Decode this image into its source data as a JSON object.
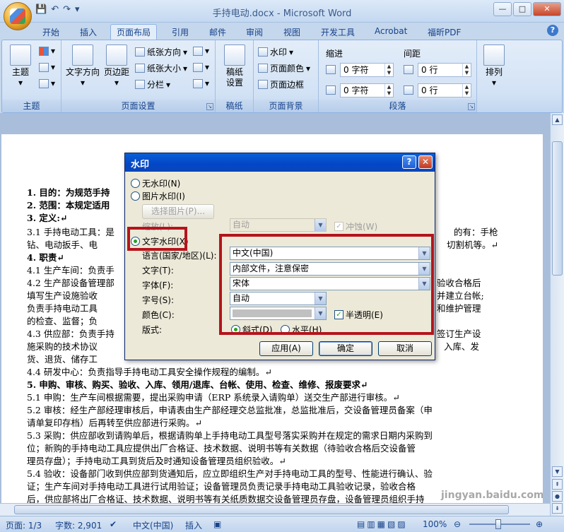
{
  "window": {
    "title": "手持电动.docx - Microsoft Word",
    "buttons": {
      "minimize": "—",
      "maximize": "□",
      "close": "✕"
    }
  },
  "qat": {
    "save": "💾",
    "undo": "↶",
    "redo": "↷",
    "customize": "▾"
  },
  "tabs": [
    "开始",
    "插入",
    "页面布局",
    "引用",
    "邮件",
    "审阅",
    "视图",
    "开发工具",
    "Acrobat",
    "福昕PDF"
  ],
  "active_tab": "页面布局",
  "ribbon": {
    "theme": {
      "label": "主题",
      "btn": "主题"
    },
    "page_setup": {
      "label": "页面设置",
      "text_dir": "文字方向",
      "margins": "页边距",
      "orientation": "纸张方向",
      "size": "纸张大小",
      "columns": "分栏"
    },
    "draft": {
      "label": "稿纸",
      "btn_line1": "稿纸",
      "btn_line2": "设置"
    },
    "background": {
      "label": "页面背景",
      "watermark": "水印",
      "page_color": "页面颜色",
      "page_border": "页面边框"
    },
    "paragraph": {
      "label": "段落",
      "indent": "缩进",
      "spacing": "间距",
      "indent_left": "0 字符",
      "indent_right": "0 字符",
      "space_before": "0 行",
      "space_after": "0 行"
    },
    "arrange": {
      "label": "排列",
      "btn": "排列"
    }
  },
  "document": {
    "lines": [
      "1.  目的：为规范手持",
      "2.  范围：本规定适用",
      "3.  定义:↵",
      "  3.1 手持电动工具：是",
      "      钻、电动扳手、电",
      "4.  职责↵",
      "  4.1 生产车间：负责手",
      "  4.2 生产部设备管理部",
      "      填写生产设施验收",
      "      负责手持电动工具",
      "      的检查、监督；负",
      "  4.3 供应部：负责手持",
      "      施采购的技术协议",
      "      货、退货、储存工",
      "  4.4 研发中心：负责指导手持电动工具安全操作规程的编制。↵",
      "5.  申购、审核、购买、验收、入库、领用/退库、台帐、使用、检查、维修、报废要求↵",
      "  5.1 申购：生产车间根据需要，提出采购申请（ERP 系统录入请购单）送交生产部进行审核。↵",
      "  5.2 审核：经生产部经理审核后，申请表由生产部经理交总监批准，总监批准后，交设备管理员备案（申",
      "      请单复印存档）后再转至供应部进行采购。↵",
      "  5.3 采购：供应部收到请购单后，根据请购单上手持电动工具型号落实采购并在规定的需求日期内采购到",
      "      位；新购的手持电动工具应提供出厂合格证、技术数据、说明书等有关数据（待验收合格后交设备管",
      "      理员存盘）；手持电动工具到货后及时通知设备管理员组织验收。↵",
      "  5.4 验收：设备部门收到供应部到货通知后，应立即组织生产对手持电动工具的型号、性能进行确认、验",
      "      证；生产车间对手持电动工具进行试用验证；设备管理员负责记录手持电动工具验收记录，验收合格",
      "      后，供应部将出厂合格证、技术数据、说明书等有关纸质数据交设备管理员存盘，设备管理员组织手持"
    ],
    "right_fragments": [
      "的有：手枪",
      "切割机等。↵",
      "验收合格后",
      "并建立台帐;",
      "和维护管理",
      "签订生产设",
      "入库、发"
    ]
  },
  "dialog": {
    "title": "水印",
    "help": "?",
    "close": "✕",
    "no_watermark": "无水印(N)",
    "picture_watermark": "图片水印(I)",
    "select_picture": "选择图片(P)...",
    "scale_label": "缩放(L):",
    "scale_value": "自动",
    "washout": "冲蚀(W)",
    "text_watermark": "文字水印(X)",
    "language_label": "语言(国家/地区)(L):",
    "language_value": "中文(中国)",
    "text_label": "文字(T):",
    "text_value": "内部文件，注意保密",
    "font_label": "字体(F):",
    "font_value": "宋体",
    "size_label": "字号(S):",
    "size_value": "自动",
    "color_label": "颜色(C):",
    "semitransparent": "半透明(E)",
    "layout_label": "版式:",
    "diagonal": "斜式(D)",
    "horizontal": "水平(H)",
    "apply": "应用(A)",
    "ok": "确定",
    "cancel": "取消"
  },
  "status": {
    "page": "页面: 1/3",
    "words": "字数: 2,901",
    "language": "中文(中国)",
    "mode": "插入",
    "zoom": "100%",
    "minus": "⊖",
    "plus": "⊕"
  },
  "site_watermark": "jingyan.baidu.com",
  "colors": {
    "accent": "#15428b",
    "highlight": "#b5141c",
    "dialog_title": "#0346c6"
  }
}
